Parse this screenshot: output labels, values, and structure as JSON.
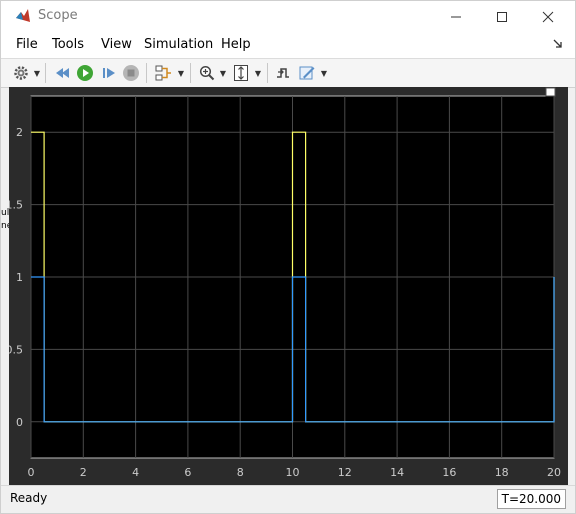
{
  "window": {
    "title": "Scope",
    "minimize": "—",
    "maximize": "☐",
    "close": "✕"
  },
  "menu": [
    "File",
    "Tools",
    "View",
    "Simulation",
    "Help"
  ],
  "toolbar": {
    "items": [
      "settings-gear-icon",
      "step-back-icon",
      "run-icon",
      "step-forward-icon",
      "stop-icon",
      "signal-select-icon",
      "zoom-in-icon",
      "scale-axes-icon",
      "triggers-icon",
      "style-icon"
    ]
  },
  "status": {
    "text": "Ready",
    "time": "T=20.000"
  },
  "background_fragments": [
    "ul",
    "ne"
  ],
  "colors": {
    "plot_bg": "#000000",
    "panel_bg": "#2b2b2b",
    "series1": "#ffff66",
    "series2": "#3399ff"
  },
  "chart_data": {
    "type": "line",
    "step": true,
    "xlim": [
      0,
      20
    ],
    "ylim": [
      -0.25,
      2.25
    ],
    "xticks": [
      0,
      2,
      4,
      6,
      8,
      10,
      12,
      14,
      16,
      18,
      20
    ],
    "yticks": [
      0,
      0.5,
      1,
      1.5,
      2
    ],
    "grid": true,
    "series": [
      {
        "color": "#ffff66",
        "x": [
          0,
          0.5,
          0.5,
          10,
          10,
          10.5,
          10.5,
          20,
          20
        ],
        "y": [
          2,
          2,
          0,
          0,
          2,
          2,
          0,
          0,
          1
        ]
      },
      {
        "color": "#3399ff",
        "x": [
          0,
          0.5,
          0.5,
          10,
          10,
          10.5,
          10.5,
          20,
          20
        ],
        "y": [
          1,
          1,
          0,
          0,
          1,
          1,
          0,
          0,
          1
        ]
      }
    ]
  }
}
